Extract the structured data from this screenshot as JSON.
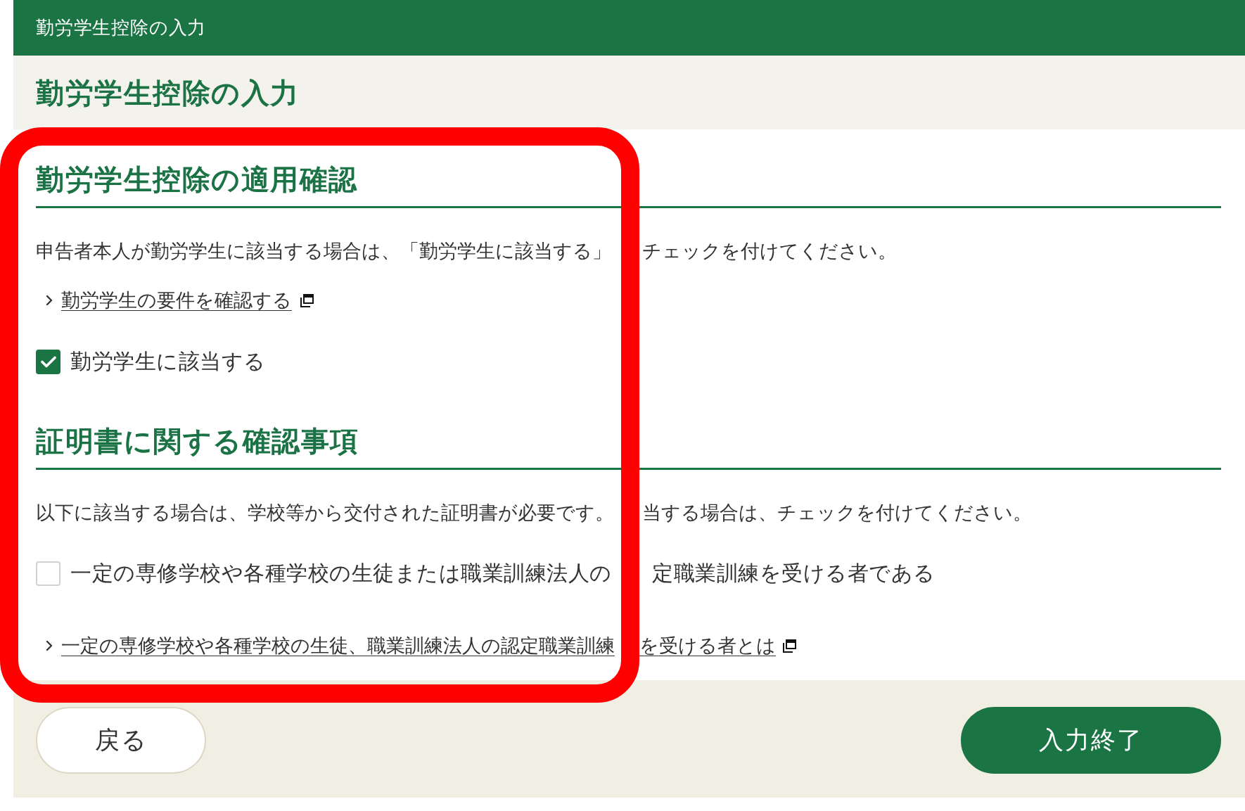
{
  "header": {
    "title": "勤労学生控除の入力"
  },
  "page_title": "勤労学生控除の入力",
  "sections": [
    {
      "heading": "勤労学生控除の適用確認",
      "items": [
        {
          "kind": "text",
          "parts": [
            "申告者本人が勤労学生に該当する場合は、「勤労学生に該当する」",
            "チェックを付けてください。"
          ]
        },
        {
          "kind": "link",
          "parts": [
            "勤労学生の要件を確認する"
          ]
        },
        {
          "kind": "checkbox",
          "checked": true,
          "parts": [
            "勤労学生に該当する"
          ]
        }
      ]
    },
    {
      "heading": "証明書に関する確認事項",
      "items": [
        {
          "kind": "text",
          "parts": [
            "以下に該当する場合は、学校等から交付された証明書が必要です。",
            "当する場合は、チェックを付けてください。"
          ]
        },
        {
          "kind": "checkbox",
          "checked": false,
          "parts": [
            "一定の専修学校や各種学校の生徒または職業訓練法人の",
            "定職業訓練を受ける者である"
          ]
        },
        {
          "kind": "link",
          "parts": [
            "一定の専修学校や各種学校の生徒、職業訓練法人の認定職業訓練",
            "を受ける者とは"
          ]
        }
      ]
    }
  ],
  "footer": {
    "buttons": [
      {
        "label": "戻る",
        "kind": "secondary"
      },
      {
        "label": "入力終了",
        "kind": "primary"
      }
    ]
  },
  "annotation": {
    "kind": "frame"
  }
}
